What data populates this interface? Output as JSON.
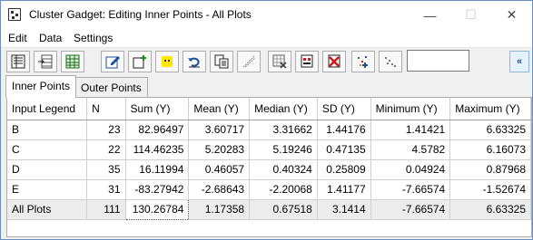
{
  "window": {
    "title": "Cluster Gadget: Editing Inner Points - All Plots",
    "minimize_glyph": "—",
    "maximize_glyph": "☐",
    "close_glyph": "✕"
  },
  "menu": [
    "Edit",
    "Data",
    "Settings"
  ],
  "toolbar": {
    "icons": [
      "extract-data-icon",
      "insert-rows-icon",
      "table-icon",
      "edit-cluster-icon",
      "add-cluster-icon",
      "highlight-icon",
      "undo-icon",
      "copy-icon",
      "draw-line-icon",
      "mask-points-icon",
      "mask-cluster-icon",
      "delete-cluster-icon",
      "select-points-icon",
      "cluster-points-icon"
    ],
    "input_value": "",
    "collapse_glyph": "«"
  },
  "tabs": [
    "Inner Points",
    "Outer Points"
  ],
  "table": {
    "columns": [
      "Input Legend",
      "N",
      "Sum (Y)",
      "Mean (Y)",
      "Median (Y)",
      "SD (Y)",
      "Minimum (Y)",
      "Maximum (Y)"
    ],
    "rows": [
      [
        "B",
        "23",
        "82.96497",
        "3.60717",
        "3.31662",
        "1.44176",
        "1.41421",
        "6.63325"
      ],
      [
        "C",
        "22",
        "114.46235",
        "5.20283",
        "5.19246",
        "0.47135",
        "4.5782",
        "6.16073"
      ],
      [
        "D",
        "35",
        "16.11994",
        "0.46057",
        "0.40324",
        "0.25809",
        "0.04924",
        "0.87968"
      ],
      [
        "E",
        "31",
        "-83.27942",
        "-2.68643",
        "-2.20068",
        "1.41177",
        "-7.66574",
        "-1.52674"
      ],
      [
        "All Plots",
        "111",
        "130.26784",
        "1.17358",
        "0.67518",
        "3.1414",
        "-7.66574",
        "6.63325"
      ]
    ]
  },
  "colors": {
    "accent": "#1a4f9c",
    "grid_line": "#d0d0d0",
    "total_row": "#ececec"
  }
}
